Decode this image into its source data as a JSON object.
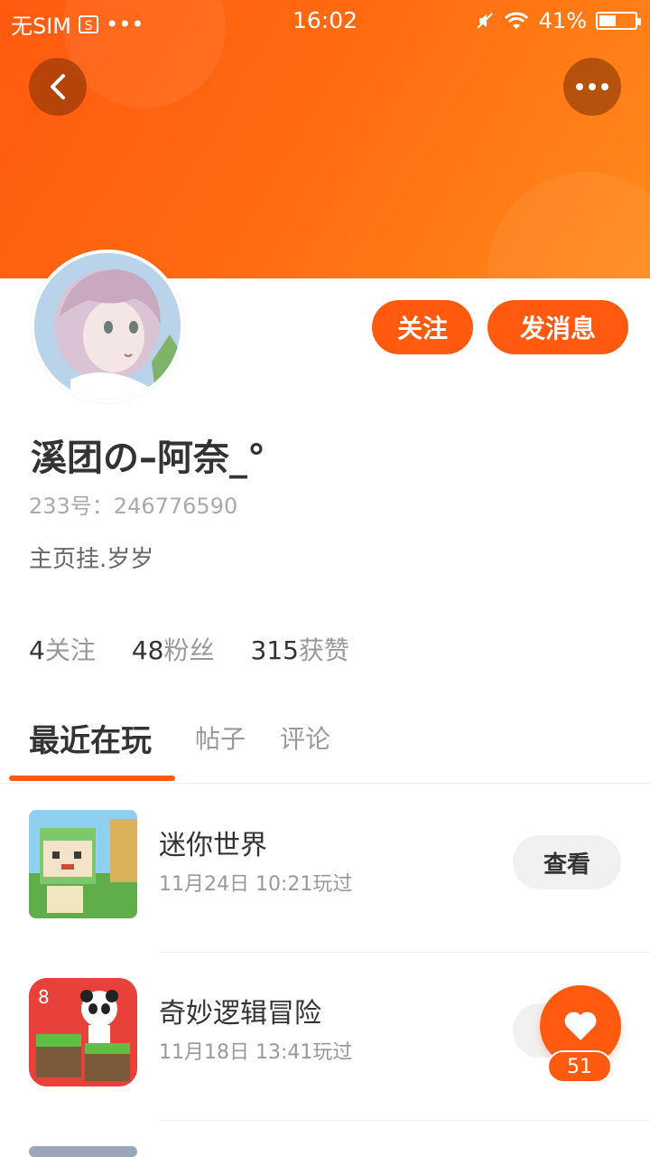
{
  "status_bar": {
    "carrier": "无SIM",
    "sim_icon_text": "S",
    "dots": "•••",
    "time": "16:02",
    "battery": "41%"
  },
  "header": {
    "back_icon": "chevron-left-icon",
    "more_icon": "more-dots-icon",
    "colors": {
      "hero_start": "#ff5a10",
      "hero_end": "#ff8a1c"
    }
  },
  "profile": {
    "follow_label": "关注",
    "message_label": "发消息",
    "username": "溪团の–阿奈_°",
    "uid": "233号：246776590",
    "bio": "主页挂.岁岁"
  },
  "stats": [
    {
      "num": "4",
      "label": "关注"
    },
    {
      "num": "48",
      "label": "粉丝"
    },
    {
      "num": "315",
      "label": "获赞"
    }
  ],
  "tabs": [
    {
      "label": "最近在玩"
    },
    {
      "label": "帖子"
    },
    {
      "label": "评论"
    }
  ],
  "games": [
    {
      "name": "迷你世界",
      "played": "11月24日 10:21玩过",
      "button": "查看"
    },
    {
      "name": "奇妙逻辑冒险",
      "played": "11月18日 13:41玩过",
      "button": "查看"
    }
  ],
  "floating_like": {
    "count": "51",
    "icon": "heart-icon"
  },
  "accent_color": "#ff5a0f"
}
